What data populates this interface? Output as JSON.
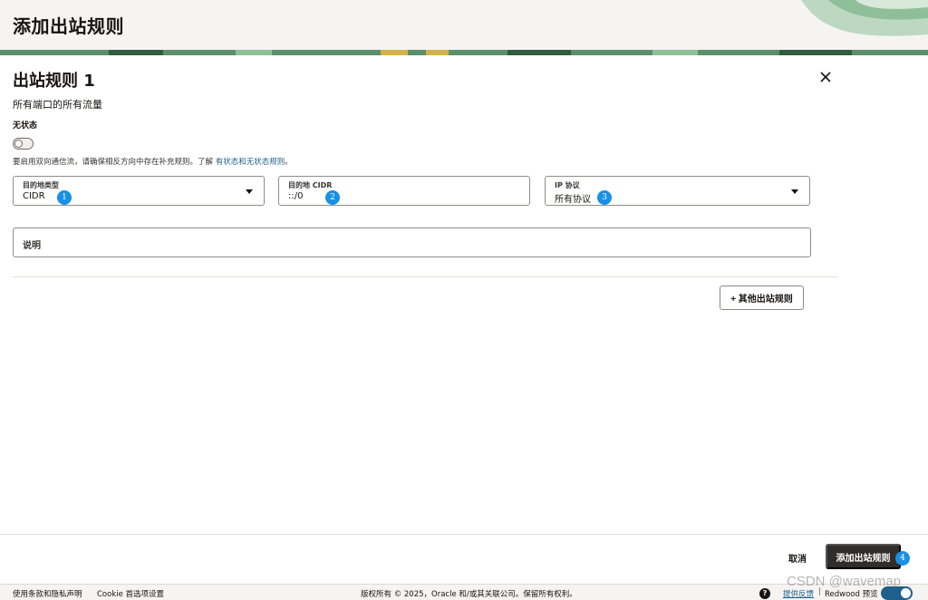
{
  "header": {
    "title": "添加出站规则"
  },
  "panel": {
    "title": "出站规则 1",
    "description": "所有端口的所有流量",
    "stateless_label": "无状态",
    "stateless_enabled": false,
    "hint_text": "要启用双向通信流，请确保相反方向中存在补充规则。了解",
    "hint_link": "有状态和无状态规则",
    "hint_suffix": "。"
  },
  "fields": {
    "dest_type": {
      "label": "目的地类型",
      "value": "CIDR",
      "badge": "1"
    },
    "dest_cidr": {
      "label": "目的地 CIDR",
      "value": "::/0",
      "badge": "2"
    },
    "ip_protocol": {
      "label": "IP 协议",
      "value": "所有协议",
      "badge": "3"
    },
    "description": {
      "label": "说明"
    }
  },
  "actions": {
    "add_other": "+ 其他出站规则",
    "cancel": "取消",
    "submit": "添加出站规则",
    "submit_badge": "4"
  },
  "footer": {
    "terms": "使用条款和隐私声明",
    "cookie": "Cookie 首选项设置",
    "copyright": "版权所有 © 2025，Oracle 和/或其关联公司。保留所有权利。",
    "help": "?",
    "feedback": "提供反馈",
    "separator": "|",
    "redwood_preview": "Redwood 预览",
    "redwood_enabled": true
  },
  "watermark": "CSDN @wavemap",
  "colors": {
    "accent_blue": "#1890e6",
    "link": "#1f5f8b",
    "primary_button": "#312d2a"
  }
}
